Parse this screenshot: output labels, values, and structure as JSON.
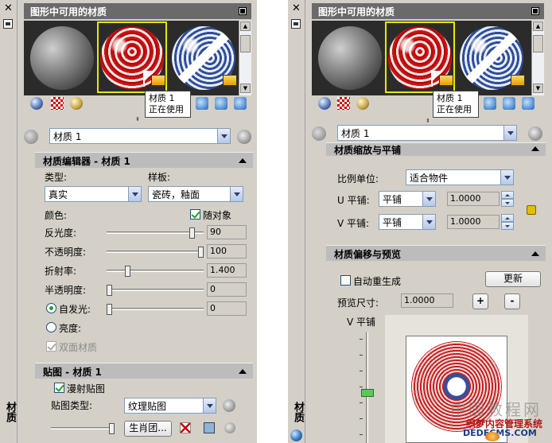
{
  "panel_title": "图形中可用的材质",
  "side_title": "材质",
  "tooltip": {
    "line1": "材质 1",
    "line2": "正在使用"
  },
  "material_name": "材质 1",
  "editor": {
    "header": "材质编辑器 - 材质 1",
    "type_label": "类型:",
    "type_value": "真实",
    "template_label": "样板:",
    "template_value": "瓷砖，釉面",
    "color_label": "颜色:",
    "by_object_label": "随对象",
    "by_object_checked": true,
    "shininess_label": "反光度:",
    "shininess_value": "90",
    "opacity_label": "不透明度:",
    "opacity_value": "100",
    "refraction_label": "折射率:",
    "refraction_value": "1.400",
    "translucency_label": "半透明度:",
    "translucency_value": "0",
    "self_illum_label": "自发光:",
    "self_illum_value": "0",
    "luminance_label": "亮度:",
    "two_sided_label": "双面材质"
  },
  "map": {
    "header": "贴图 - 材质 1",
    "diffuse_label": "漫射贴图",
    "diffuse_checked": true,
    "map_type_label": "贴图类型:",
    "map_type_value": "纹理贴图",
    "file_button": "生肖团..."
  },
  "scaling": {
    "header": "材质缩放与平铺",
    "unit_label": "比例单位:",
    "unit_value": "适合物件",
    "u_label": "U 平铺:",
    "u_mode": "平铺",
    "u_value": "1.0000",
    "v_label": "V 平铺:",
    "v_mode": "平铺",
    "v_value": "1.0000"
  },
  "offset": {
    "header": "材质偏移与预览",
    "auto_regen_label": "自动重生成",
    "auto_regen_checked": false,
    "update_button": "更新",
    "preview_size_label": "预览尺寸:",
    "preview_size_value": "1.0000",
    "plus_button": "+",
    "minus_button": "-",
    "v_tile_label": "V 平铺"
  },
  "sliders": {
    "shininess": 0.9,
    "opacity": 1.0,
    "refraction": 0.2,
    "translucency": 0.0,
    "self_illum": 0.0,
    "map_blend": 1.0,
    "v_tile": 0.55
  },
  "watermark": {
    "line1": "中国教程网",
    "line2": "织梦内容管理系统",
    "line3": "DEDECMS.COM"
  },
  "colors": {
    "selection_frame": "#e8e800",
    "title_bar": "#6a6a6a",
    "section_header": "#bcbcbc",
    "check_green": "#21a121"
  }
}
